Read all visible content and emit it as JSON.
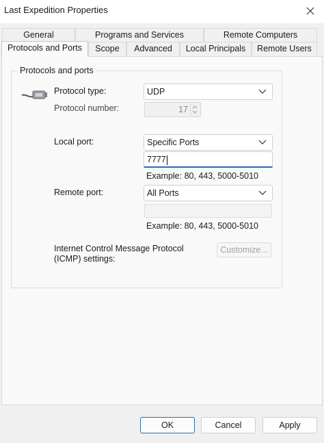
{
  "window": {
    "title": "Last Expedition Properties"
  },
  "tabs": {
    "row_back": [
      "General",
      "Programs and Services",
      "Remote Computers"
    ],
    "row_front": [
      "Protocols and Ports",
      "Scope",
      "Advanced",
      "Local Principals",
      "Remote Users"
    ],
    "selected": "Protocols and Ports"
  },
  "group": {
    "title": "Protocols and ports",
    "protocol_type_label": "Protocol type:",
    "protocol_type_value": "UDP",
    "protocol_number_label": "Protocol number:",
    "protocol_number_value": "17",
    "local_port_label": "Local port:",
    "local_port_value": "Specific Ports",
    "local_port_text": "7777",
    "local_port_example": "Example: 80, 443, 5000-5010",
    "remote_port_label": "Remote port:",
    "remote_port_value": "All Ports",
    "remote_port_text": "",
    "remote_port_example": "Example: 80, 443, 5000-5010",
    "icmp_label_line1": "Internet Control Message Protocol",
    "icmp_label_line2": "(ICMP) settings:",
    "customize_label": "Customize..."
  },
  "buttons": {
    "ok": "OK",
    "cancel": "Cancel",
    "apply": "Apply"
  },
  "icons": {
    "close": "close-icon",
    "protocol": "network-cable-icon",
    "dropdown": "chevron-down-icon"
  },
  "colors": {
    "accent": "#2b6cb3",
    "panel_bg": "#f9f9f9",
    "window_bg": "#f0f0f0"
  }
}
